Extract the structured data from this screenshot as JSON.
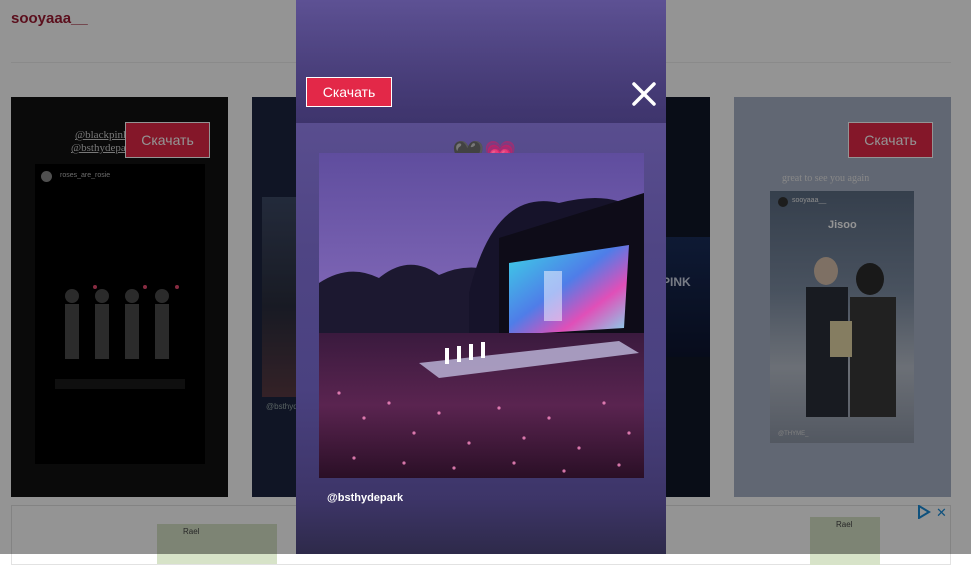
{
  "profile": {
    "username": "sooyaaa__"
  },
  "download_label": "Скачать",
  "cards": [
    {
      "mentions": [
        "@blackpink",
        "@bsthydepark"
      ],
      "story_user": "roses_are_rosie"
    },
    {
      "mention": "@bsthydepark"
    },
    {
      "stage_text": "PINK"
    },
    {
      "caption": "great to see you again",
      "story_user": "sooyaaa__",
      "sticker_text": "Jisoo",
      "credit": "@THYME_"
    }
  ],
  "modal": {
    "download_label": "Скачать",
    "close_icon": "close-icon",
    "hearts": "🖤💗",
    "mention": "@bsthydepark"
  },
  "ad": {
    "choices_icon": "adchoices-icon",
    "close_label": "✕",
    "thumb_label": "Rael"
  }
}
